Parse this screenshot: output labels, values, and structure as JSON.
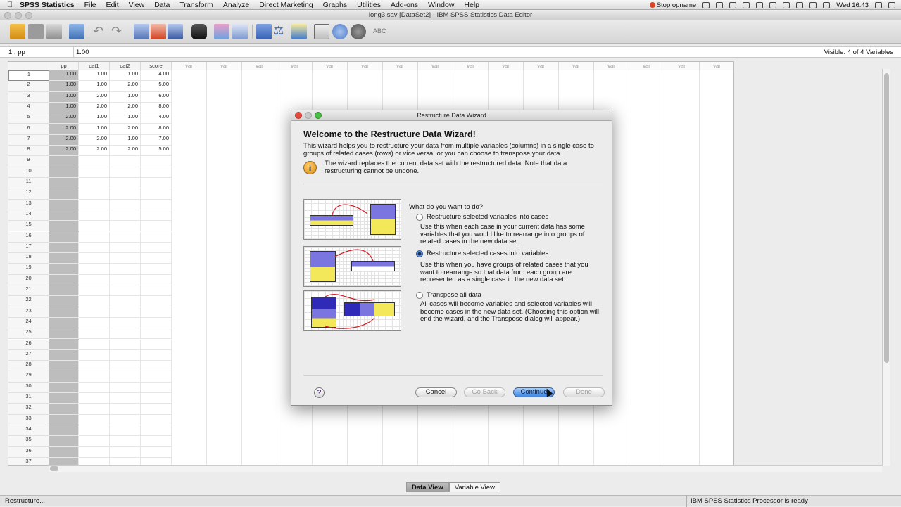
{
  "menubar": {
    "app_name": "SPSS Statistics",
    "items": [
      "File",
      "Edit",
      "View",
      "Data",
      "Transform",
      "Analyze",
      "Direct Marketing",
      "Graphs",
      "Utilities",
      "Add-ons",
      "Window",
      "Help"
    ],
    "stop_label": "Stop opname",
    "clock": "Wed 16:43"
  },
  "window": {
    "title": "long3.sav [DataSet2] - IBM SPSS Statistics Data Editor"
  },
  "cellbar": {
    "ref": "1 : pp",
    "value": "1.00",
    "visible": "Visible: 4 of 4 Variables"
  },
  "grid": {
    "columns": [
      "pp",
      "cat1",
      "cat2",
      "score"
    ],
    "var_label": "var",
    "rows": [
      [
        "1.00",
        "1.00",
        "1.00",
        "4.00"
      ],
      [
        "1.00",
        "1.00",
        "2.00",
        "5.00"
      ],
      [
        "1.00",
        "2.00",
        "1.00",
        "6.00"
      ],
      [
        "1.00",
        "2.00",
        "2.00",
        "8.00"
      ],
      [
        "2.00",
        "1.00",
        "1.00",
        "4.00"
      ],
      [
        "2.00",
        "1.00",
        "2.00",
        "8.00"
      ],
      [
        "2.00",
        "2.00",
        "1.00",
        "7.00"
      ],
      [
        "2.00",
        "2.00",
        "2.00",
        "5.00"
      ]
    ],
    "row_numbers": [
      "1",
      "2",
      "3",
      "4",
      "5",
      "6",
      "7",
      "8",
      "9",
      "10",
      "11",
      "12",
      "13",
      "14",
      "15",
      "16",
      "17",
      "18",
      "19",
      "20",
      "21",
      "22",
      "23",
      "24",
      "25",
      "26",
      "27",
      "28",
      "29",
      "30",
      "31",
      "32",
      "33",
      "34",
      "35",
      "36",
      "37"
    ]
  },
  "view_tabs": [
    "Data View",
    "Variable View"
  ],
  "status": {
    "left": "Restructure...",
    "right": "IBM SPSS Statistics Processor is ready"
  },
  "dialog": {
    "title": "Restructure Data Wizard",
    "heading": "Welcome to the Restructure Data Wizard!",
    "intro": "This wizard helps you to restructure your data from multiple variables (columns) in a single case to groups of related cases (rows) or vice versa, or you can choose to transpose your data.",
    "warning": "The wizard replaces the current data set with the restructured data.  Note that data restructuring cannot be undone.",
    "question": "What do you want to do?",
    "options": [
      {
        "label": "Restructure selected variables into cases",
        "desc": "Use this when each case in your current data has some variables that you would like to rearrange into groups of related cases in the new data set.",
        "selected": false
      },
      {
        "label": "Restructure selected cases into variables",
        "desc": "Use this when you have groups of related cases that you want to rearrange so that data from each group are represented as a single case in the new data set.",
        "selected": true
      },
      {
        "label": "Transpose all data",
        "desc": "All cases will become variables and selected variables will become cases in the new data set. (Choosing this option will end the wizard, and the Transpose dialog will appear.)",
        "selected": false
      }
    ],
    "buttons": {
      "cancel": "Cancel",
      "back": "Go Back",
      "continue": "Continue",
      "done": "Done"
    },
    "help_glyph": "?"
  },
  "colors": {
    "accent": "#3d86e6",
    "pp_column": "#bdbdbd",
    "illus_blue": "#7b75e0",
    "illus_yellow": "#f2e85a"
  }
}
